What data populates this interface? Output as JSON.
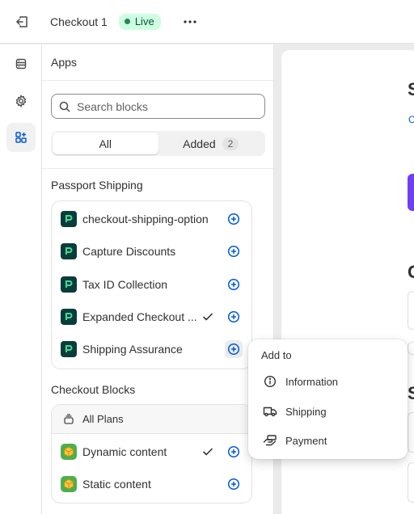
{
  "topbar": {
    "title": "Checkout 1",
    "status_label": "Live",
    "status_color": "#cdfee1",
    "more_icon": "more-horizontal-icon",
    "exit_icon": "exit-icon"
  },
  "rail": {
    "items": [
      {
        "name": "sections-icon",
        "active": false
      },
      {
        "name": "gear-icon",
        "active": false
      },
      {
        "name": "apps-icon",
        "active": true
      }
    ]
  },
  "panel": {
    "title": "Apps",
    "search_placeholder": "Search blocks",
    "tabs": [
      {
        "label": "All",
        "active": true
      },
      {
        "label": "Added",
        "count": "2",
        "active": false
      }
    ]
  },
  "passport": {
    "title": "Passport Shipping",
    "items": [
      {
        "label": "checkout-shipping-option",
        "added": false
      },
      {
        "label": "Capture Discounts",
        "added": false
      },
      {
        "label": "Tax ID Collection",
        "added": false
      },
      {
        "label": "Expanded Checkout ...",
        "added": true
      },
      {
        "label": "Shipping Assurance",
        "added": false
      }
    ]
  },
  "checkout_blocks": {
    "title": "Checkout Blocks",
    "plans_label": "All Plans",
    "items": [
      {
        "label": "Dynamic content",
        "added": true
      },
      {
        "label": "Static content",
        "added": false
      }
    ]
  },
  "popover": {
    "title": "Add to",
    "items": [
      {
        "label": "Information",
        "icon": "info-icon"
      },
      {
        "label": "Shipping",
        "icon": "truck-icon"
      },
      {
        "label": "Payment",
        "icon": "payment-icon"
      }
    ]
  },
  "preview": {
    "heading_1": "S",
    "link_1": "C",
    "heading_2": "C",
    "heading_3": "S",
    "accent_color": "#6e3ff3"
  }
}
